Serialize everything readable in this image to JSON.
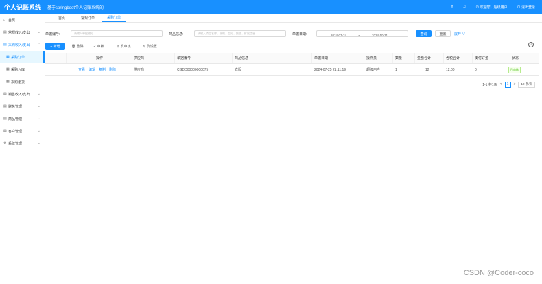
{
  "app": {
    "title": "个人记账系统",
    "subtitle": "基于springboot个人记账系统的"
  },
  "header": {
    "search_icon": "search-icon",
    "bell_icon": "bell-icon",
    "user_label": "⊙ 欢迎您，超级用户",
    "logout_label": "⊙ 退出登录"
  },
  "sidebar": {
    "items": [
      {
        "label": "首页",
        "icon": "home-icon"
      },
      {
        "label": "常规收入/支出",
        "icon": "doc-icon"
      },
      {
        "label": "采购收入/支出",
        "icon": "doc-icon"
      },
      {
        "label": "采购订单",
        "icon": "list-icon"
      },
      {
        "label": "采购入库",
        "icon": "list-icon"
      },
      {
        "label": "采购退货",
        "icon": "list-icon"
      },
      {
        "label": "销售收入/支出",
        "icon": "doc-icon"
      },
      {
        "label": "财务管理",
        "icon": "doc-icon"
      },
      {
        "label": "商品管理",
        "icon": "doc-icon"
      },
      {
        "label": "客户管理",
        "icon": "doc-icon"
      },
      {
        "label": "系统管理",
        "icon": "gear-icon"
      }
    ]
  },
  "tabs": [
    {
      "label": "首页"
    },
    {
      "label": "常规订单"
    },
    {
      "label": "采购订单"
    }
  ],
  "filters": {
    "order_no_label": "单据编号:",
    "order_no_placeholder": "请输入单据编号",
    "product_label": "商品信息:",
    "product_placeholder": "请输入商品名称、规格、型号、颜色、扩展信息",
    "date_label": "单据日期:",
    "date_start": "2024-07-24",
    "date_sep": "~",
    "date_end": "2024-10-31",
    "search_button": "查询",
    "reset_button": "重置",
    "expand_link": "展开 ∨"
  },
  "toolbar": {
    "add": "+ 新增",
    "delete": "删除",
    "audit": "审核",
    "unaudit": "反审核",
    "column_settings": "列设置"
  },
  "table": {
    "headers": [
      "操作",
      "供应商",
      "单据编号",
      "商品信息",
      "单据日期",
      "操作员",
      "数量",
      "金额合计",
      "含税合计",
      "支付订金",
      "状态"
    ],
    "rows": [
      {
        "ops": [
          "查看",
          "编辑",
          "复制",
          "删除"
        ],
        "supplier": "供应商",
        "order_no": "CGDD00000000075",
        "product": "衣服",
        "date": "2024-07-25 21:11:19",
        "operator": "超级用户",
        "qty": "1",
        "amount": "12",
        "tax_total": "12.00",
        "deposit": "0",
        "status": "已审核"
      }
    ]
  },
  "pager": {
    "total": "1-1 共1条",
    "prev": "<",
    "current": "1",
    "next": ">",
    "page_size": "10 条/页"
  },
  "watermark": "CSDN @Coder-coco",
  "colors": {
    "primary": "#1890ff",
    "success": "#52c41a"
  }
}
